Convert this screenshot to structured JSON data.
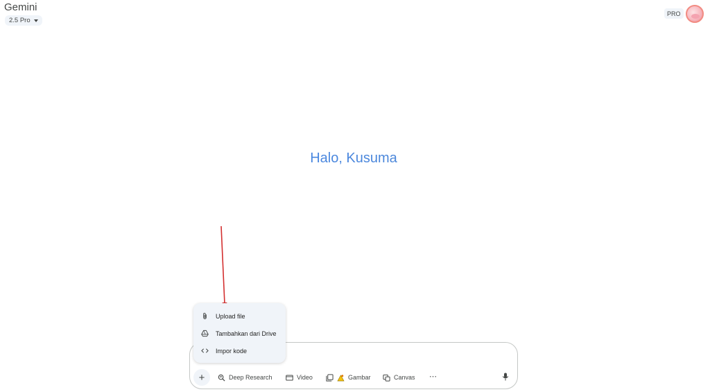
{
  "app": {
    "title": "Gemini",
    "model": "2.5 Pro",
    "pro_badge": "PRO"
  },
  "greeting": "Halo, Kusuma",
  "menu": {
    "items": [
      {
        "label": "Upload file",
        "icon": "paperclip-icon"
      },
      {
        "label": "Tambahkan dari Drive",
        "icon": "drive-icon"
      },
      {
        "label": "Impor kode",
        "icon": "code-icon"
      }
    ]
  },
  "toolbar": {
    "add_icon": "+",
    "tools": [
      {
        "label": "Deep Research",
        "icon": "deep-research-icon"
      },
      {
        "label": "Video",
        "icon": "video-icon"
      },
      {
        "label": "Gambar",
        "icon": "image-icon"
      },
      {
        "label": "Canvas",
        "icon": "canvas-icon"
      }
    ],
    "more": "⋯",
    "mic_icon": "microphone-icon"
  },
  "colors": {
    "greeting": "#4a86d8",
    "annotation_arrow": "#d32f2f",
    "menu_bg": "#f0f4f9"
  }
}
